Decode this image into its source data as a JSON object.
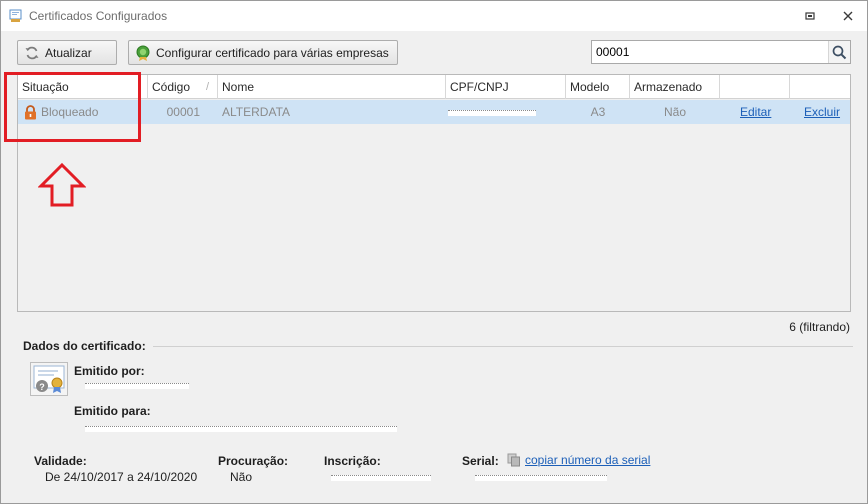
{
  "window": {
    "title": "Certificados Configurados"
  },
  "toolbar": {
    "refresh_label": "Atualizar",
    "configure_label": "Configurar certificado para várias empresas"
  },
  "search": {
    "value": "00001"
  },
  "grid": {
    "columns": [
      "Situação",
      "Código",
      "Nome",
      "CPF/CNPJ",
      "Modelo",
      "Armazenado",
      ""
    ],
    "rows": [
      {
        "situacao": "Bloqueado",
        "codigo": "00001",
        "nome": "ALTERDATA",
        "cpf_cnpj": "",
        "modelo": "A3",
        "armazenado": "Não",
        "editar": "Editar",
        "excluir": "Excluir"
      }
    ],
    "count_text": "6 (filtrando)"
  },
  "details": {
    "section_title": "Dados do certificado:",
    "emitido_por_label": "Emitido por:",
    "emitido_por_value": "",
    "emitido_para_label": "Emitido para:",
    "emitido_para_value": "",
    "validade_label": "Validade:",
    "validade_value": "De 24/10/2017 a 24/10/2020",
    "procuracao_label": "Procuração:",
    "procuracao_value": "Não",
    "inscricao_label": "Inscrição:",
    "inscricao_value": "",
    "serial_label": "Serial:",
    "serial_value": "",
    "copy_serial_label": "copiar número da serial"
  },
  "colors": {
    "selected_row": "#cfe3f5",
    "link": "#1c5fb8",
    "annotation_red": "#e21d24",
    "lock_orange": "#e0722a"
  },
  "icons": {
    "title": "certificate-window-icon",
    "refresh": "refresh-icon",
    "configure": "green-seal-icon",
    "search": "search-icon",
    "lock": "lock-icon",
    "certificate": "certificate-icon",
    "copy": "copy-icon",
    "annotation": "up-arrow-icon"
  }
}
